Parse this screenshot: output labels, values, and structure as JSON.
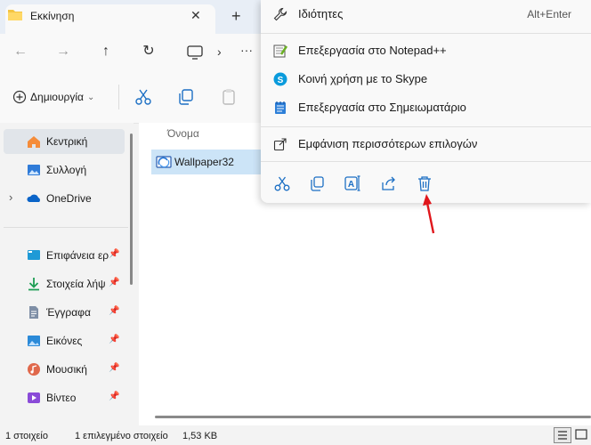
{
  "tab": {
    "title": "Εκκίνηση",
    "close": "✕",
    "new": "+"
  },
  "nav": {
    "back": "←",
    "forward": "→",
    "up": "↑",
    "refresh": "↻",
    "more": "···"
  },
  "toolbar": {
    "new_label": "Δημιουργία",
    "new_chevron": "⌄"
  },
  "sidebar": {
    "items": [
      {
        "label": "Κεντρική",
        "icon": "home-icon"
      },
      {
        "label": "Συλλογή",
        "icon": "gallery-icon"
      },
      {
        "label": "OneDrive",
        "icon": "onedrive-icon",
        "expander": "›"
      },
      {
        "label": "Επιφάνεια ερ",
        "icon": "desktop-icon",
        "pin": "📌"
      },
      {
        "label": "Στοιχεία λήψ",
        "icon": "download-icon",
        "pin": "📌"
      },
      {
        "label": "Έγγραφα",
        "icon": "documents-icon",
        "pin": "📌"
      },
      {
        "label": "Εικόνες",
        "icon": "pictures-icon",
        "pin": "📌"
      },
      {
        "label": "Μουσική",
        "icon": "music-icon",
        "pin": "📌"
      },
      {
        "label": "Βίντεο",
        "icon": "video-icon",
        "pin": "📌"
      }
    ]
  },
  "content": {
    "column_name": "Όνομα",
    "file": {
      "name": "Wallpaper32",
      "icon": "screensaver-file-icon"
    }
  },
  "status": {
    "items": "1 στοιχείο",
    "selected": "1 επιλεγμένο στοιχείο",
    "size": "1,53 KB"
  },
  "context_menu": {
    "properties": {
      "label": "Ιδιότητες",
      "shortcut": "Alt+Enter"
    },
    "notepadpp": "Επεξεργασία στο Notepad++",
    "skype": "Κοινή χρήση με το Skype",
    "notepad": "Επεξεργασία στο Σημειωματάριο",
    "more_options": "Εμφάνιση περισσότερων επιλογών",
    "quick_actions": [
      "cut-icon",
      "copy-icon",
      "rename-icon",
      "share-icon",
      "delete-icon"
    ]
  },
  "colors": {
    "accent": "#0067c0",
    "annotation_arrow": "#e0161b",
    "selection": "#cce4f7"
  }
}
